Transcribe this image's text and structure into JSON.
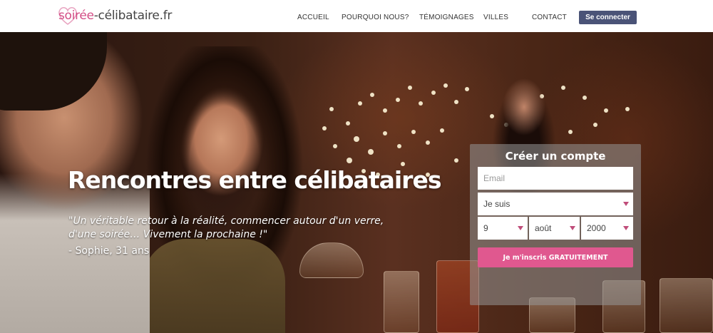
{
  "logo": {
    "part1": "soirée",
    "part2": "-célibataire.fr"
  },
  "nav": {
    "items": [
      "ACCUEIL",
      "POURQUOI NOUS?",
      "TÉMOIGNAGES",
      "VILLES",
      "CONTACT"
    ],
    "login_label": "Se connecter"
  },
  "hero": {
    "title": "Rencontres entre célibataires",
    "quote": "\"Un véritable retour à la réalité, commencer autour d'un verre, d'une soirée… Vivement la prochaine !\"",
    "author": "- Sophie, 31 ans"
  },
  "signup": {
    "title": "Créer un compte",
    "email_placeholder": "Email",
    "gender_value": "Je suis",
    "day_value": "9",
    "month_value": "août",
    "year_value": "2000",
    "submit_label": "Je m'inscris GRATUITEMENT"
  },
  "colors": {
    "accent": "#e0588f",
    "login_bg": "#4a5377",
    "caret": "#c04d7a"
  }
}
